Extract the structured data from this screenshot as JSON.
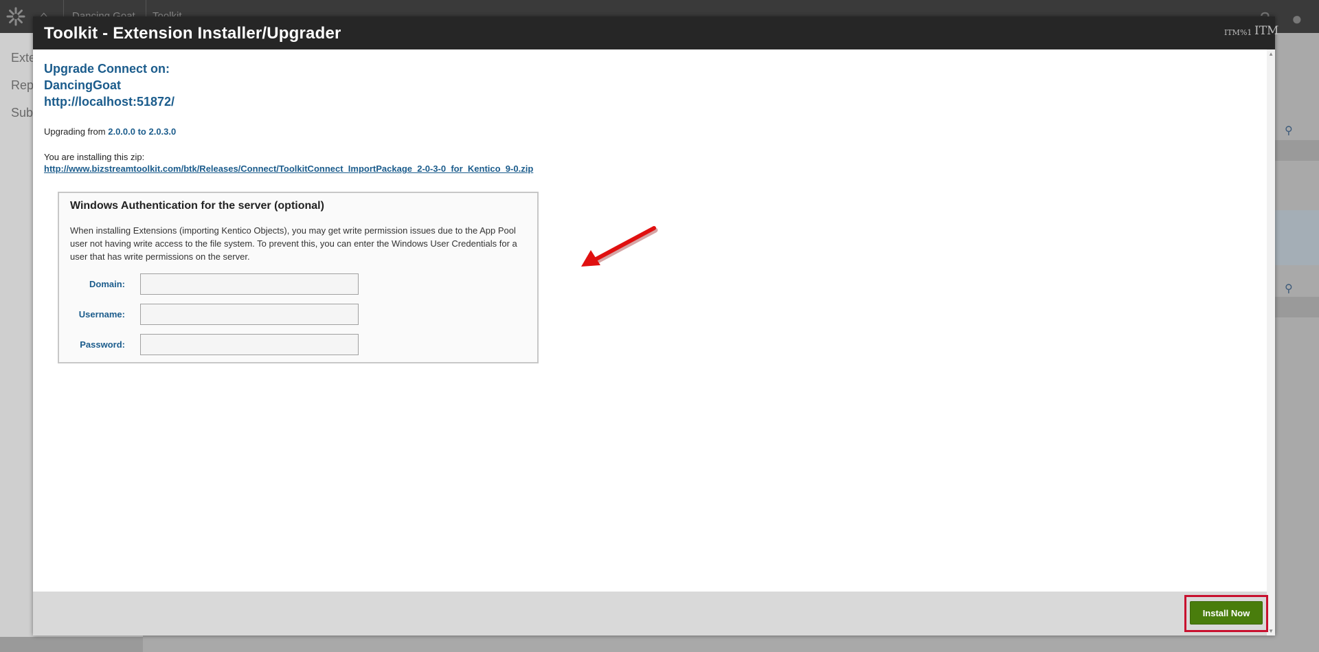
{
  "background": {
    "breadcrumbs": [
      "Dancing Goat",
      "Toolkit"
    ],
    "left_items": [
      "Exte",
      "Repo",
      "Subs"
    ]
  },
  "modal": {
    "title": "Toolkit - Extension Installer/Upgrader",
    "header_controls": [
      "ITM%1",
      "ITM"
    ],
    "upgrade_heading": {
      "line1": "Upgrade Connect on:",
      "line2": "DancingGoat",
      "line3": "http://localhost:51872/"
    },
    "upgrading": {
      "prefix": "Upgrading from",
      "versions": "2.0.0.0 to 2.0.3.0"
    },
    "zip": {
      "label": "You are installing this zip:",
      "url": "http://www.bizstreamtoolkit.com/btk/Releases/Connect/ToolkitConnect_ImportPackage_2-0-3-0_for_Kentico_9-0.zip"
    },
    "auth": {
      "title": "Windows Authentication for the server (optional)",
      "description": "When installing Extensions (importing Kentico Objects), you may get write permission issues due to the App Pool user not having write access to the file system. To prevent this, you can enter the Windows User Credentials for a user that has write permissions on the server.",
      "fields": [
        {
          "label": "Domain:",
          "value": ""
        },
        {
          "label": "Username:",
          "value": ""
        },
        {
          "label": "Password:",
          "value": ""
        }
      ]
    },
    "footer": {
      "install_label": "Install Now"
    }
  },
  "colors": {
    "accent_blue": "#1b5c8c",
    "install_green": "#497d0c",
    "highlight_red": "#c8102e"
  }
}
